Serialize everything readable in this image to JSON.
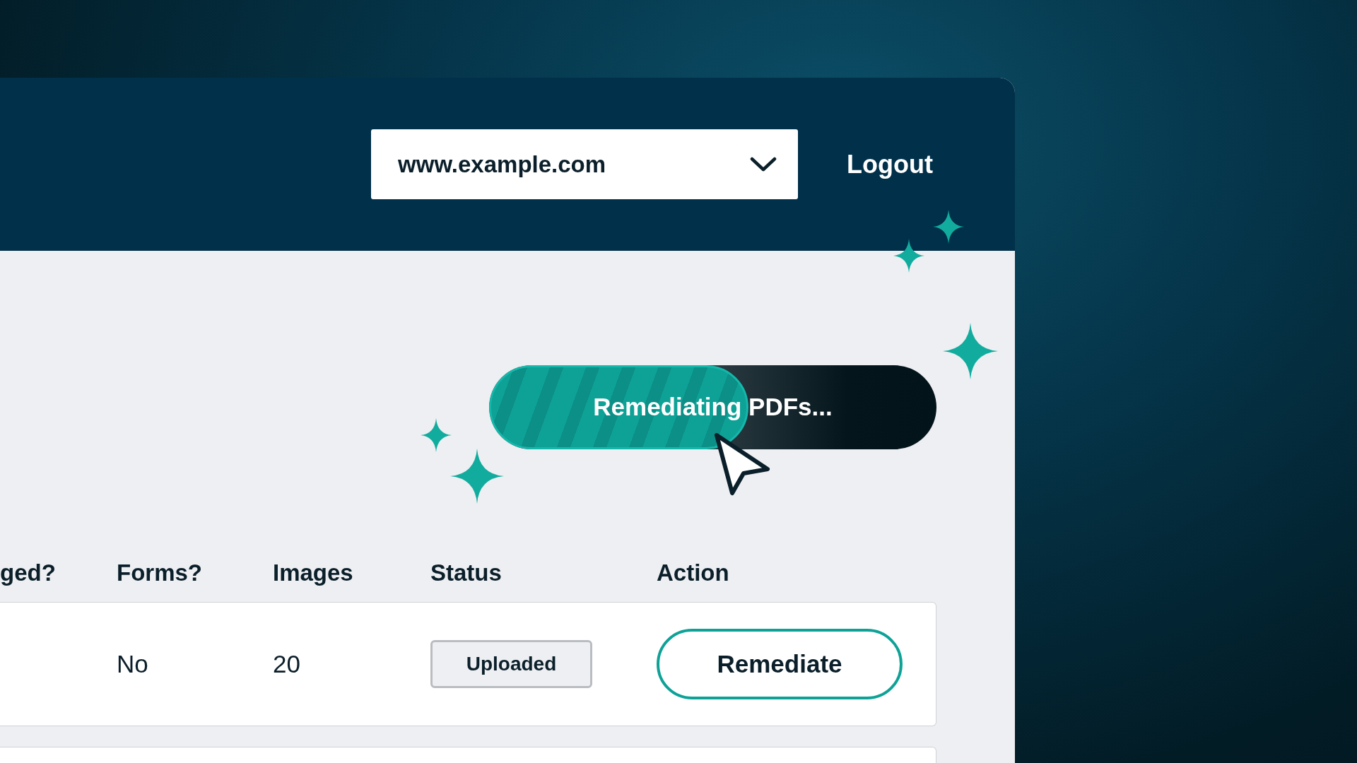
{
  "header": {
    "site_select": {
      "value": "www.example.com"
    },
    "logout": "Logout"
  },
  "progress": {
    "label": "Remediating PDFs...",
    "level": 0.58
  },
  "table": {
    "columns": [
      "ged?",
      "Forms?",
      "Images",
      "Status",
      "Action"
    ],
    "rows": [
      {
        "column_1": "",
        "forms": "No",
        "images": "20",
        "status": "Uploaded",
        "action": "Remediate"
      }
    ]
  }
}
